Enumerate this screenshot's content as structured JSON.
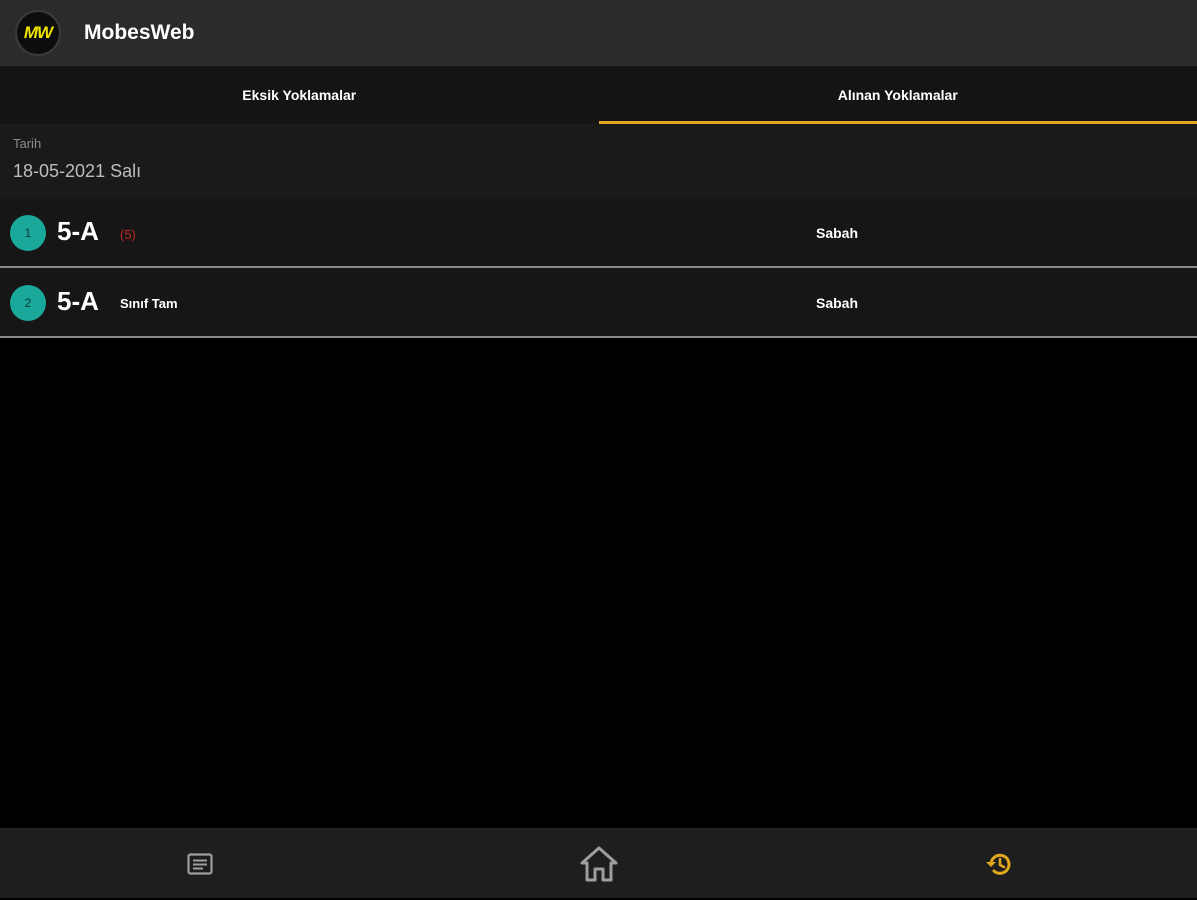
{
  "header": {
    "logo_text": "MW",
    "title": "MobesWeb"
  },
  "tabs": [
    {
      "label": "Eksik Yoklamalar",
      "active": false
    },
    {
      "label": "Alınan Yoklamalar",
      "active": true
    }
  ],
  "date": {
    "label": "Tarih",
    "value": "18-05-2021 Salı"
  },
  "list": [
    {
      "index": "1",
      "class": "5-A",
      "count": "(5)",
      "note": "",
      "session": "Sabah"
    },
    {
      "index": "2",
      "class": "5-A",
      "count": "",
      "note": "Sınıf Tam",
      "session": "Sabah"
    }
  ],
  "bottom_nav": [
    {
      "icon": "list-icon",
      "active": false
    },
    {
      "icon": "home-icon",
      "active": false
    },
    {
      "icon": "history-icon",
      "active": true
    }
  ],
  "colors": {
    "accent": "#e0a81d",
    "badge": "#1aa89b",
    "count_red": "#c0261f",
    "logo_yellow": "#f2e600"
  }
}
